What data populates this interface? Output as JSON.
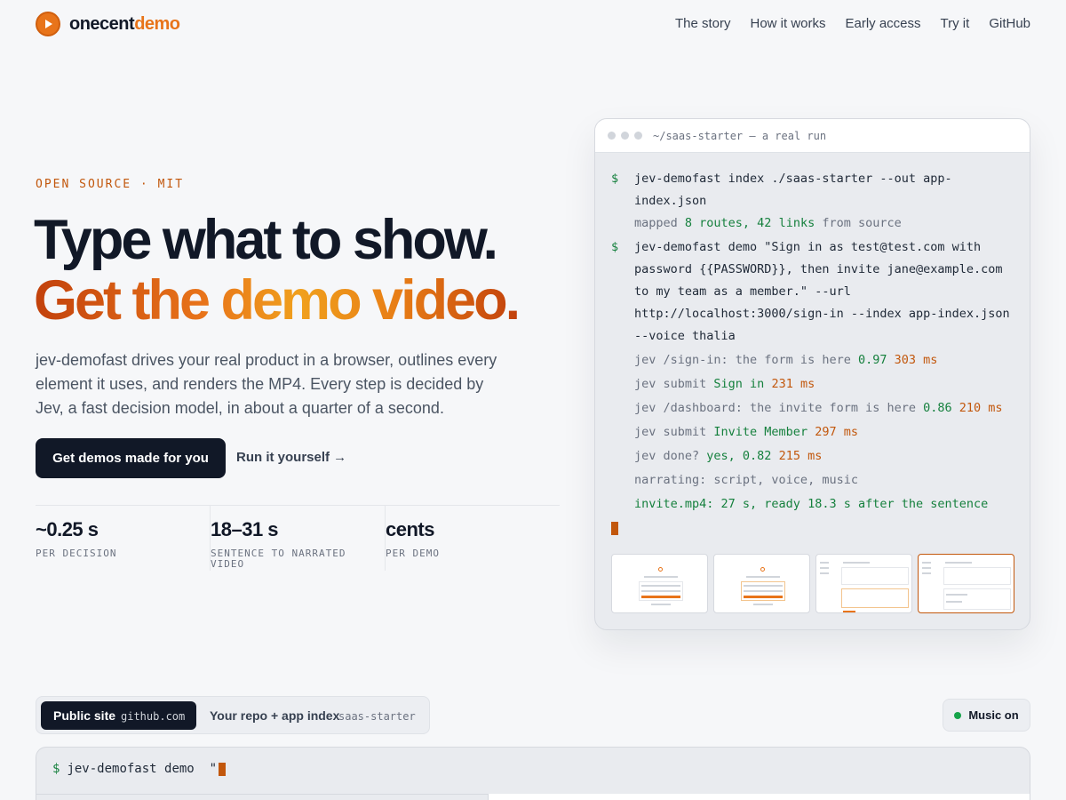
{
  "brand": {
    "part1": "onecent",
    "part2": "demo"
  },
  "nav": [
    {
      "label": "The story"
    },
    {
      "label": "How it works"
    },
    {
      "label": "Early access"
    },
    {
      "label": "Try it"
    },
    {
      "label": "GitHub"
    }
  ],
  "hero": {
    "eyebrow": "OPEN SOURCE · MIT",
    "title_line1": "Type what to show.",
    "title_line2": "Get the demo video.",
    "lede": "jev-demofast drives your real product in a browser, outlines every element it uses, and renders the MP4. Every step is decided by Jev, a fast decision model, in about a quarter of a second.",
    "cta_primary": "Get demos made for you",
    "cta_secondary": "Run it yourself →"
  },
  "stats": [
    {
      "value": "~0.25 s",
      "label": "PER DECISION"
    },
    {
      "value": "18–31 s",
      "label": "SENTENCE TO NARRATED VIDEO"
    },
    {
      "value": "cents",
      "label": "PER DEMO"
    }
  ],
  "terminal": {
    "title": "~/saas-starter — a real run",
    "prompt": "$",
    "cmd1": "jev-demofast index ./saas-starter --out app-index.json",
    "out1": {
      "a": "mapped ",
      "b": "8 routes, 42 links",
      "c": " from source"
    },
    "cmd2": "jev-demofast demo \"Sign in as test@test.com with password {{PASSWORD}}, then invite jane@example.com to my team as a member.\" --url http://localhost:3000/sign-in --index app-index.json --voice thalia",
    "lines": [
      {
        "a": "jev /sign-in: the form is here ",
        "b": "0.97",
        "c": " 303 ms"
      },
      {
        "a": "jev submit ",
        "b": "Sign in",
        "c": " 231 ms"
      },
      {
        "a": "jev /dashboard: the invite form is here ",
        "b": "0.86",
        "c": " 210 ms"
      },
      {
        "a": "jev submit ",
        "b": "Invite Member",
        "c": " 297 ms"
      },
      {
        "a": "jev done? ",
        "b": "yes, 0.82",
        "c": " 215 ms"
      }
    ],
    "narrating": "narrating: script, voice, music",
    "result": "invite.mp4: 27 s, ready 18.3 s after the sentence"
  },
  "toggle": {
    "public": {
      "label": "Public site",
      "sub": "github.com"
    },
    "repo": {
      "label": "Your repo + app index",
      "sub": "saas-starter"
    }
  },
  "music": {
    "label": "Music on"
  },
  "cmd": {
    "prompt": "$",
    "text": "jev-demofast demo  \""
  },
  "colors": {
    "accent": "#e8741a",
    "dark": "#111827",
    "green": "#15803d",
    "orange_text": "#c2570c"
  }
}
